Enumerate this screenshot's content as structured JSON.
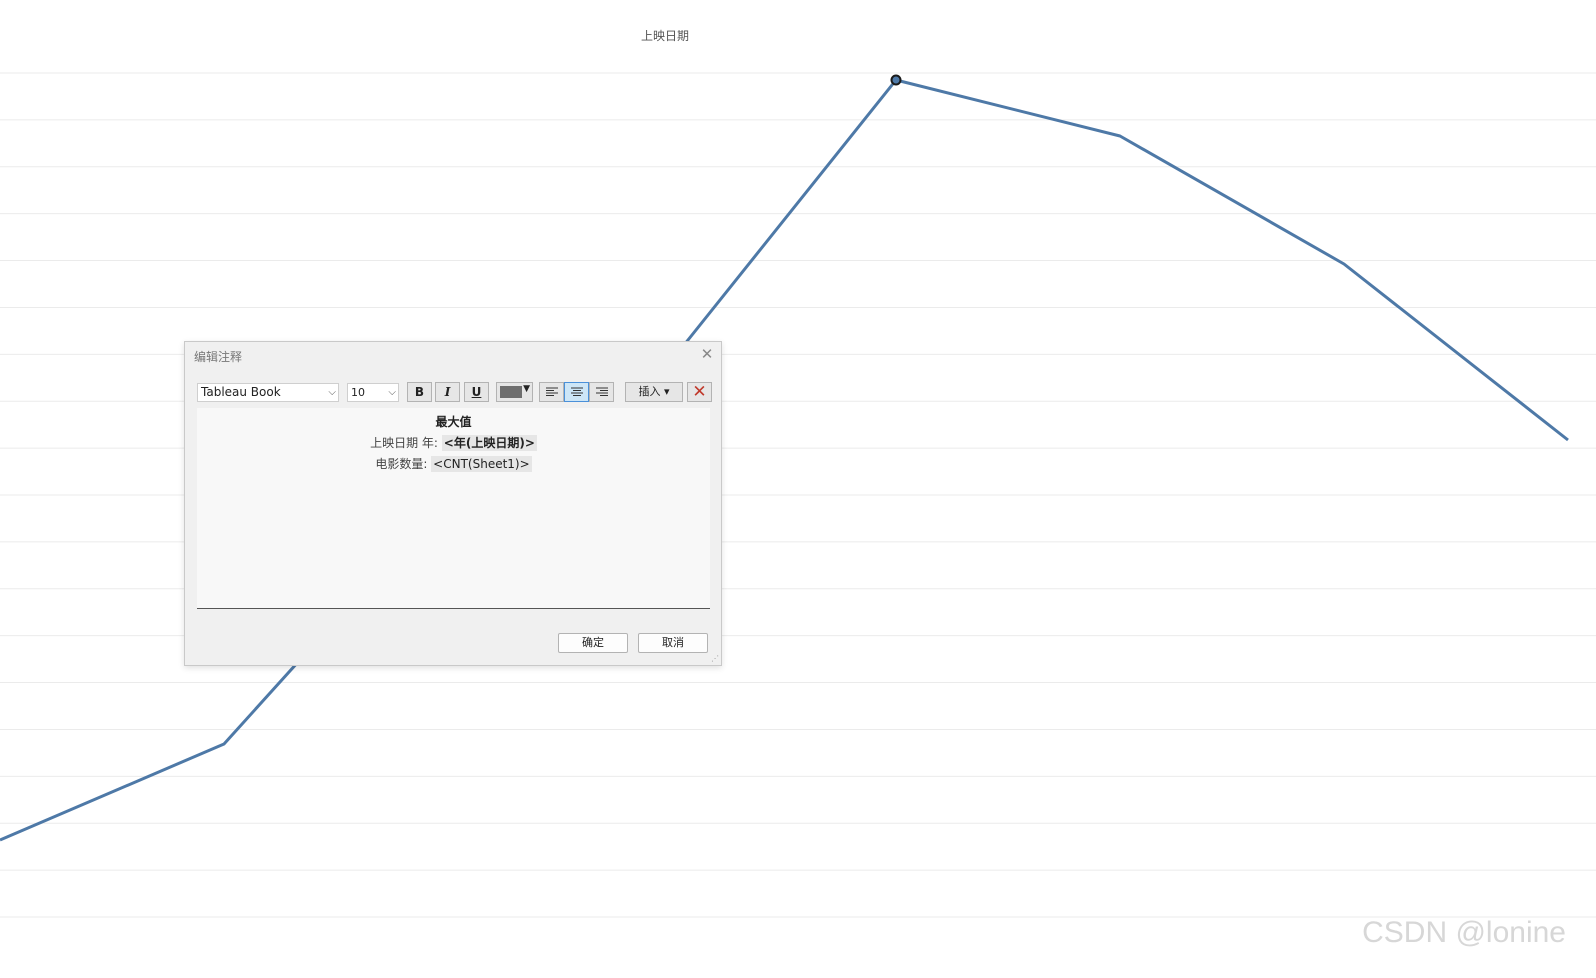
{
  "chart_data": {
    "type": "line",
    "title": "上映日期",
    "series": [
      {
        "values": [
          10,
          22,
          53,
          70,
          105,
          98,
          82,
          60
        ],
        "color": "#4e79a7"
      }
    ],
    "max_point_index": 4,
    "grid": "horizontal",
    "ylim": [
      0,
      110
    ]
  },
  "dialog": {
    "title": "编辑注释",
    "font": "Tableau Book",
    "font_size": "10",
    "bold_label": "B",
    "italic_label": "I",
    "underline_label": "U",
    "text_color": "#6e6e6e",
    "insert_label": "插入 ▾",
    "editor": {
      "line1": "最大值",
      "line2_label": "上映日期 年: ",
      "line2_field": "<年(上映日期)>",
      "line3_label": "电影数量: ",
      "line3_field": "<CNT(Sheet1)>"
    },
    "ok_label": "确定",
    "cancel_label": "取消"
  },
  "watermark": "CSDN @lonine"
}
